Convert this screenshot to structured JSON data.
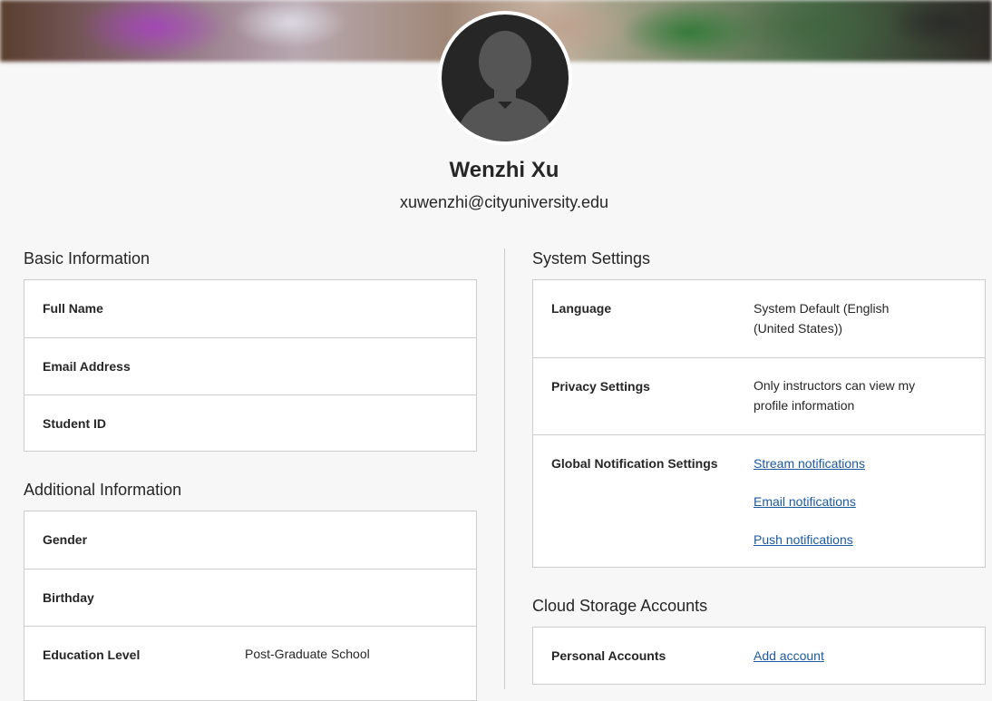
{
  "profile": {
    "name": "Wenzhi Xu",
    "email": "xuwenzhi@cityuniversity.edu"
  },
  "basic_info": {
    "title": "Basic Information",
    "rows": [
      {
        "label": "Full Name",
        "value": ""
      },
      {
        "label": "Email Address",
        "value": ""
      },
      {
        "label": "Student ID",
        "value": ""
      }
    ]
  },
  "additional_info": {
    "title": "Additional Information",
    "rows": [
      {
        "label": "Gender",
        "value": ""
      },
      {
        "label": "Birthday",
        "value": ""
      },
      {
        "label": "Education Level",
        "value": "Post-Graduate School"
      }
    ]
  },
  "system_settings": {
    "title": "System Settings",
    "language": {
      "label": "Language",
      "value": "System Default (English (United States))"
    },
    "privacy": {
      "label": "Privacy Settings",
      "value": "Only instructors can view my profile information"
    },
    "notifications": {
      "label": "Global Notification Settings",
      "links": [
        "Stream notifications",
        "Email notifications",
        "Push notifications"
      ]
    }
  },
  "cloud_storage": {
    "title": "Cloud Storage Accounts",
    "personal": {
      "label": "Personal Accounts",
      "link": "Add account"
    }
  },
  "colors": {
    "background": "#f7f7f7",
    "link": "#1c5aa0",
    "border": "#cdcdcd",
    "avatar": "#262626"
  }
}
